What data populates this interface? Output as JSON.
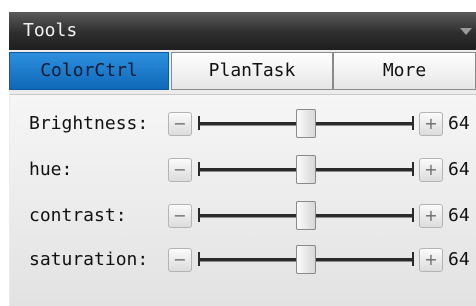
{
  "panel": {
    "title": "Tools",
    "collapse_icon": "triangle-down-icon"
  },
  "tabs": [
    {
      "label": "ColorCtrl",
      "active": true
    },
    {
      "label": "PlanTask",
      "active": false
    },
    {
      "label": "More",
      "active": false
    }
  ],
  "controls": [
    {
      "label": "Brightness:",
      "value": "64",
      "level": 0.5
    },
    {
      "label": "hue:",
      "value": "64",
      "level": 0.5
    },
    {
      "label": "contrast:",
      "value": "64",
      "level": 0.5
    },
    {
      "label": "saturation:",
      "value": "64",
      "level": 0.5
    }
  ],
  "buttons": {
    "decrease": "−",
    "increase": "+"
  },
  "colors": {
    "titlebar": "#2e2e2e",
    "active_tab": "#1a7bd0",
    "panel_bg": "#ececec"
  }
}
